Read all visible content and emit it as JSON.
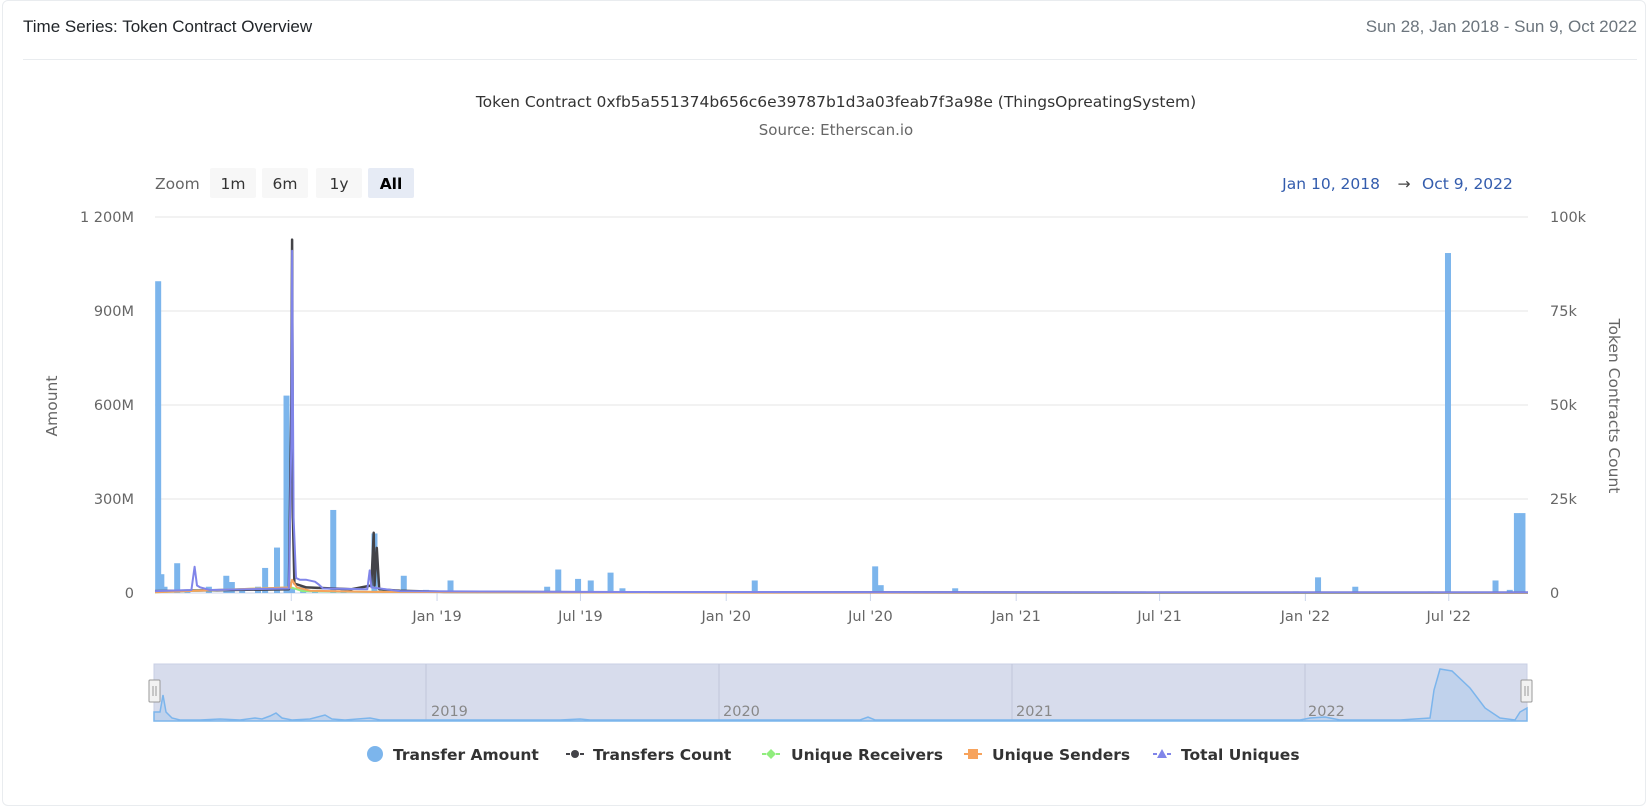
{
  "header": {
    "title": "Time Series: Token Contract Overview",
    "range": "Sun 28, Jan 2018 - Sun 9, Oct 2022"
  },
  "zoom": {
    "label": "Zoom",
    "buttons": [
      "1m",
      "6m",
      "1y",
      "All"
    ],
    "active": "All"
  },
  "range_display": {
    "from": "Jan 10, 2018",
    "arrow": "→",
    "to": "Oct 9, 2022"
  },
  "navigator": {
    "year_labels": [
      "2019",
      "2020",
      "2021",
      "2022"
    ]
  },
  "colors": {
    "transfer_amount": "#7cb5ec",
    "transfers_count": "#434348",
    "unique_receivers": "#90ed7d",
    "unique_senders": "#f7a35c",
    "total_uniques": "#8085e9"
  },
  "chart_data": {
    "type": "bar",
    "title": "Token Contract 0xfb5a551374b656c6e39787b1d3a03feab7f3a98e (ThingsOpreatingSystem)",
    "subtitle": "Source: Etherscan.io",
    "xlabel": "",
    "ylabel": "Amount",
    "ylabel_right": "Token Contracts Count",
    "x_range": [
      "2018-01-10",
      "2022-10-09"
    ],
    "x_ticks": [
      {
        "date": "2018-07-01",
        "label": "Jul '18"
      },
      {
        "date": "2019-01-01",
        "label": "Jan '19"
      },
      {
        "date": "2019-07-01",
        "label": "Jul '19"
      },
      {
        "date": "2020-01-01",
        "label": "Jan '20"
      },
      {
        "date": "2020-07-01",
        "label": "Jul '20"
      },
      {
        "date": "2021-01-01",
        "label": "Jan '21"
      },
      {
        "date": "2021-07-01",
        "label": "Jul '21"
      },
      {
        "date": "2022-01-01",
        "label": "Jan '22"
      },
      {
        "date": "2022-07-01",
        "label": "Jul '22"
      }
    ],
    "y_left": {
      "ylim": [
        0,
        1200000000
      ],
      "ticks": [
        0,
        300000000,
        600000000,
        900000000,
        1200000000
      ],
      "tick_labels": [
        "0",
        "300M",
        "600M",
        "900M",
        "1 200M"
      ]
    },
    "y_right": {
      "ylim": [
        0,
        100000
      ],
      "ticks": [
        0,
        25000,
        50000,
        75000,
        100000
      ],
      "tick_labels": [
        "0",
        "25k",
        "50k",
        "75k",
        "100k"
      ]
    },
    "legend": [
      "Transfer Amount",
      "Transfers Count",
      "Unique Receivers",
      "Unique Senders",
      "Total Uniques"
    ],
    "legend_position": "bottom",
    "series": [
      {
        "name": "Transfer Amount",
        "type": "column",
        "axis": "left",
        "points": [
          [
            "2018-01-14",
            995000000
          ],
          [
            "2018-01-18",
            60000000
          ],
          [
            "2018-01-22",
            20000000
          ],
          [
            "2018-02-07",
            95000000
          ],
          [
            "2018-02-20",
            10000000
          ],
          [
            "2018-03-19",
            20000000
          ],
          [
            "2018-04-10",
            55000000
          ],
          [
            "2018-04-17",
            35000000
          ],
          [
            "2018-04-30",
            10000000
          ],
          [
            "2018-05-20",
            20000000
          ],
          [
            "2018-05-29",
            80000000
          ],
          [
            "2018-06-13",
            145000000
          ],
          [
            "2018-06-25",
            630000000
          ],
          [
            "2018-07-02",
            15000000
          ],
          [
            "2018-07-16",
            20000000
          ],
          [
            "2018-07-31",
            10000000
          ],
          [
            "2018-08-23",
            265000000
          ],
          [
            "2018-09-05",
            15000000
          ],
          [
            "2018-10-14",
            190000000
          ],
          [
            "2018-10-28",
            10000000
          ],
          [
            "2018-11-20",
            55000000
          ],
          [
            "2018-12-18",
            10000000
          ],
          [
            "2019-01-18",
            40000000
          ],
          [
            "2019-03-01",
            5000000
          ],
          [
            "2019-05-20",
            20000000
          ],
          [
            "2019-06-03",
            75000000
          ],
          [
            "2019-06-28",
            45000000
          ],
          [
            "2019-07-14",
            40000000
          ],
          [
            "2019-08-08",
            65000000
          ],
          [
            "2019-08-23",
            15000000
          ],
          [
            "2020-02-06",
            40000000
          ],
          [
            "2020-07-07",
            85000000
          ],
          [
            "2020-07-14",
            25000000
          ],
          [
            "2020-10-16",
            15000000
          ],
          [
            "2021-05-05",
            5000000
          ],
          [
            "2021-06-10",
            5000000
          ],
          [
            "2021-12-20",
            5000000
          ],
          [
            "2022-01-17",
            50000000
          ],
          [
            "2022-03-05",
            20000000
          ],
          [
            "2022-06-08",
            5000000
          ],
          [
            "2022-06-30",
            1085000000
          ],
          [
            "2022-08-29",
            40000000
          ],
          [
            "2022-09-16",
            10000000
          ],
          [
            "2022-09-25",
            255000000
          ],
          [
            "2022-10-02",
            255000000
          ]
        ]
      },
      {
        "name": "Transfers Count",
        "type": "line",
        "axis": "right",
        "points": [
          [
            "2018-01-10",
            500
          ],
          [
            "2018-06-28",
            1000
          ],
          [
            "2018-07-01",
            50000
          ],
          [
            "2018-07-02",
            94000
          ],
          [
            "2018-07-03",
            20000
          ],
          [
            "2018-07-05",
            2500
          ],
          [
            "2018-07-20",
            1500
          ],
          [
            "2018-09-15",
            1000
          ],
          [
            "2018-10-10",
            2000
          ],
          [
            "2018-10-13",
            16000
          ],
          [
            "2018-10-14",
            2000
          ],
          [
            "2018-10-17",
            12000
          ],
          [
            "2018-10-20",
            1000
          ],
          [
            "2018-11-15",
            600
          ],
          [
            "2019-01-10",
            300
          ],
          [
            "2019-07-01",
            200
          ],
          [
            "2020-07-01",
            150
          ],
          [
            "2021-07-01",
            100
          ],
          [
            "2022-10-09",
            100
          ]
        ]
      },
      {
        "name": "Unique Receivers",
        "type": "line",
        "axis": "right",
        "points": [
          [
            "2018-01-10",
            200
          ],
          [
            "2018-07-01",
            1500
          ],
          [
            "2018-07-15",
            500
          ],
          [
            "2018-10-10",
            300
          ],
          [
            "2019-07-01",
            150
          ],
          [
            "2021-07-01",
            80
          ],
          [
            "2022-10-09",
            80
          ]
        ]
      },
      {
        "name": "Unique Senders",
        "type": "line",
        "axis": "right",
        "points": [
          [
            "2018-01-10",
            200
          ],
          [
            "2018-06-30",
            1500
          ],
          [
            "2018-07-02",
            3500
          ],
          [
            "2018-07-08",
            1500
          ],
          [
            "2018-07-25",
            600
          ],
          [
            "2018-10-10",
            300
          ],
          [
            "2019-07-01",
            150
          ],
          [
            "2022-10-09",
            80
          ]
        ]
      },
      {
        "name": "Total Uniques",
        "type": "line",
        "axis": "right",
        "points": [
          [
            "2018-01-10",
            500
          ],
          [
            "2018-02-25",
            800
          ],
          [
            "2018-03-01",
            7000
          ],
          [
            "2018-03-04",
            2000
          ],
          [
            "2018-03-08",
            1500
          ],
          [
            "2018-03-20",
            800
          ],
          [
            "2018-06-28",
            1200
          ],
          [
            "2018-07-01",
            40000
          ],
          [
            "2018-07-02",
            91000
          ],
          [
            "2018-07-04",
            20000
          ],
          [
            "2018-07-07",
            4000
          ],
          [
            "2018-07-12",
            3500
          ],
          [
            "2018-07-20",
            3500
          ],
          [
            "2018-07-31",
            3000
          ],
          [
            "2018-08-05",
            2200
          ],
          [
            "2018-08-10",
            1200
          ],
          [
            "2018-10-05",
            1000
          ],
          [
            "2018-10-08",
            6000
          ],
          [
            "2018-10-10",
            1500
          ],
          [
            "2018-11-15",
            500
          ],
          [
            "2019-07-01",
            300
          ],
          [
            "2020-07-01",
            250
          ],
          [
            "2021-07-01",
            150
          ],
          [
            "2022-10-09",
            150
          ]
        ]
      }
    ]
  }
}
